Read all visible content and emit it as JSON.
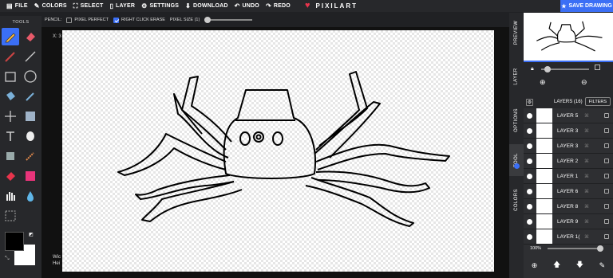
{
  "topbar": {
    "file": "FILE",
    "colors": "COLORS",
    "select": "SELECT",
    "layer": "LAYER",
    "settings": "SETTINGS",
    "download": "DOWNLOAD",
    "undo": "UNDO",
    "redo": "REDO",
    "brand": "PIXILART",
    "save": "SAVE DRAWING"
  },
  "options": {
    "tool": "PENCIL:",
    "pixel_perfect": "PIXEL PERFECT",
    "right_click_erase": "RIGHT CLICK ERASE",
    "pixel_size": "PIXEL SIZE (1)"
  },
  "toolbar": {
    "title": "TOOLS"
  },
  "canvas": {
    "coord": "X: 3",
    "dims_line1": "Wic",
    "dims_line2": "Hei"
  },
  "tabs": [
    "PREVIEW",
    "LAYER",
    "OPTIONS",
    "TOOL",
    "COLORS"
  ],
  "layers": {
    "title": "LAYERS (16)",
    "filters": "FILTERS",
    "items": [
      "LAYER 5",
      "LAYER 3",
      "LAYER 3",
      "LAYER 2",
      "LAYER 1",
      "LAYER 6",
      "LAYER 8",
      "LAYER 9",
      "LAYER 1("
    ]
  },
  "zoom": {
    "value": "100%"
  },
  "colors": {
    "accent": "#3b6ff5",
    "primary": "#000000",
    "secondary": "#ffffff",
    "brand_heart": "#e8344c"
  }
}
